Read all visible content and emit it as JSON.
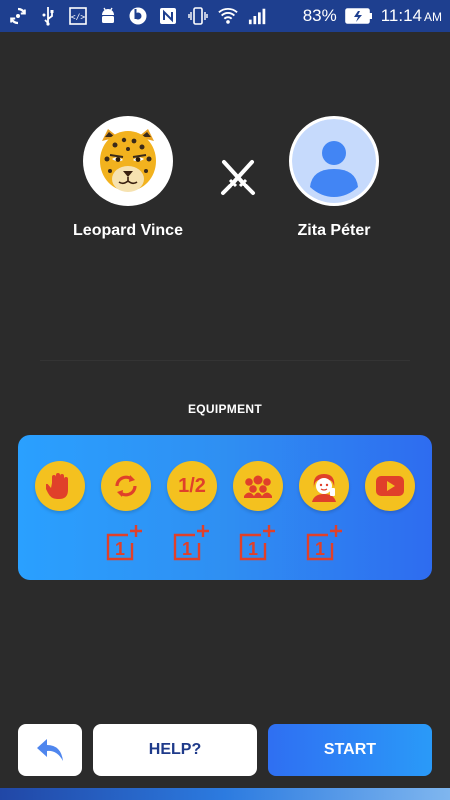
{
  "status_bar": {
    "battery_percent": "83%",
    "time": "11:14",
    "ampm": "AM",
    "icons": [
      "sync-icon",
      "usb-icon",
      "code-icon",
      "android-icon",
      "beats-icon",
      "nfc-icon",
      "vibrate-icon",
      "wifi-icon",
      "signal-icon",
      "battery-charging-icon"
    ]
  },
  "players": {
    "left": {
      "name": "Leopard Vince",
      "avatar": "leopard-avatar"
    },
    "right": {
      "name": "Zita Péter",
      "avatar": "default-person-avatar"
    },
    "versus_icon": "crossed-swords-icon"
  },
  "equipment": {
    "title": "EQUIPMENT",
    "items": [
      {
        "icon": "hand-stop-icon"
      },
      {
        "icon": "swap-refresh-icon"
      },
      {
        "icon": "half-icon",
        "label": "1/2"
      },
      {
        "icon": "audience-icon"
      },
      {
        "icon": "phone-a-friend-icon"
      },
      {
        "icon": "video-play-icon"
      }
    ],
    "plus_badges": [
      "1",
      "1",
      "1",
      "1"
    ],
    "panel_colors": [
      "#2aa0ff",
      "#2e6cf0"
    ],
    "button_color": "#f4c11f",
    "icon_color": "#e0402a"
  },
  "actions": {
    "back_icon": "reply-back-icon",
    "help_label": "HELP?",
    "start_label": "START"
  }
}
